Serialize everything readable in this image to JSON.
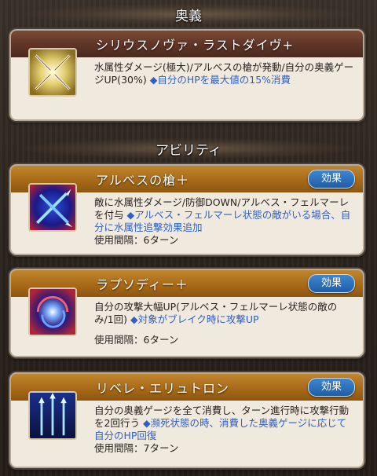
{
  "sections": {
    "ougi_header": "奥義",
    "ability_header": "アビリティ"
  },
  "ougi": {
    "name": "シリウスノヴァ・ラストダイヴ+",
    "desc": "水属性ダメージ(極大)/アルベスの槍が発動/自分の奥義ゲージUP(30%)",
    "extra": "◆自分のHPを最大値の15%消費",
    "icon": "crossed-swords-icon"
  },
  "abilities": [
    {
      "name": "アルベスの槍＋",
      "button": "効果",
      "desc": "敵に水属性ダメージ/防御DOWN/アルベス・フェルマーレを付与",
      "extra": "◆アルベス・フェルマーレ状態の敵がいる場合、自分に水属性追撃効果追加",
      "interval": "使用間隔：6ターン",
      "icon": "crossed-spears-icon"
    },
    {
      "name": "ラプソディー＋",
      "button": "効果",
      "desc": "自分の攻撃大幅UP(アルベス・フェルマーレ状態の敵のみ/1回)",
      "extra": "◆対象がブレイク時に攻撃UP",
      "interval": "使用間隔：6ターン",
      "icon": "vortex-icon"
    },
    {
      "name": "リベレ・エリュトロン",
      "button": "効果",
      "desc": "自分の奥義ゲージを全て消費し、ターン進行時に攻撃行動を2回行う",
      "extra": "◆瀕死状態の時、消費した奥義ゲージに応じて自分のHP回復",
      "interval": "使用間隔：7ターン",
      "icon": "triple-spears-icon"
    }
  ],
  "colors": {
    "highlight": "#2f5fc4",
    "button": "#1f5ea8",
    "ougi_title": "#5e3426",
    "ability_title": "#a86a18"
  }
}
